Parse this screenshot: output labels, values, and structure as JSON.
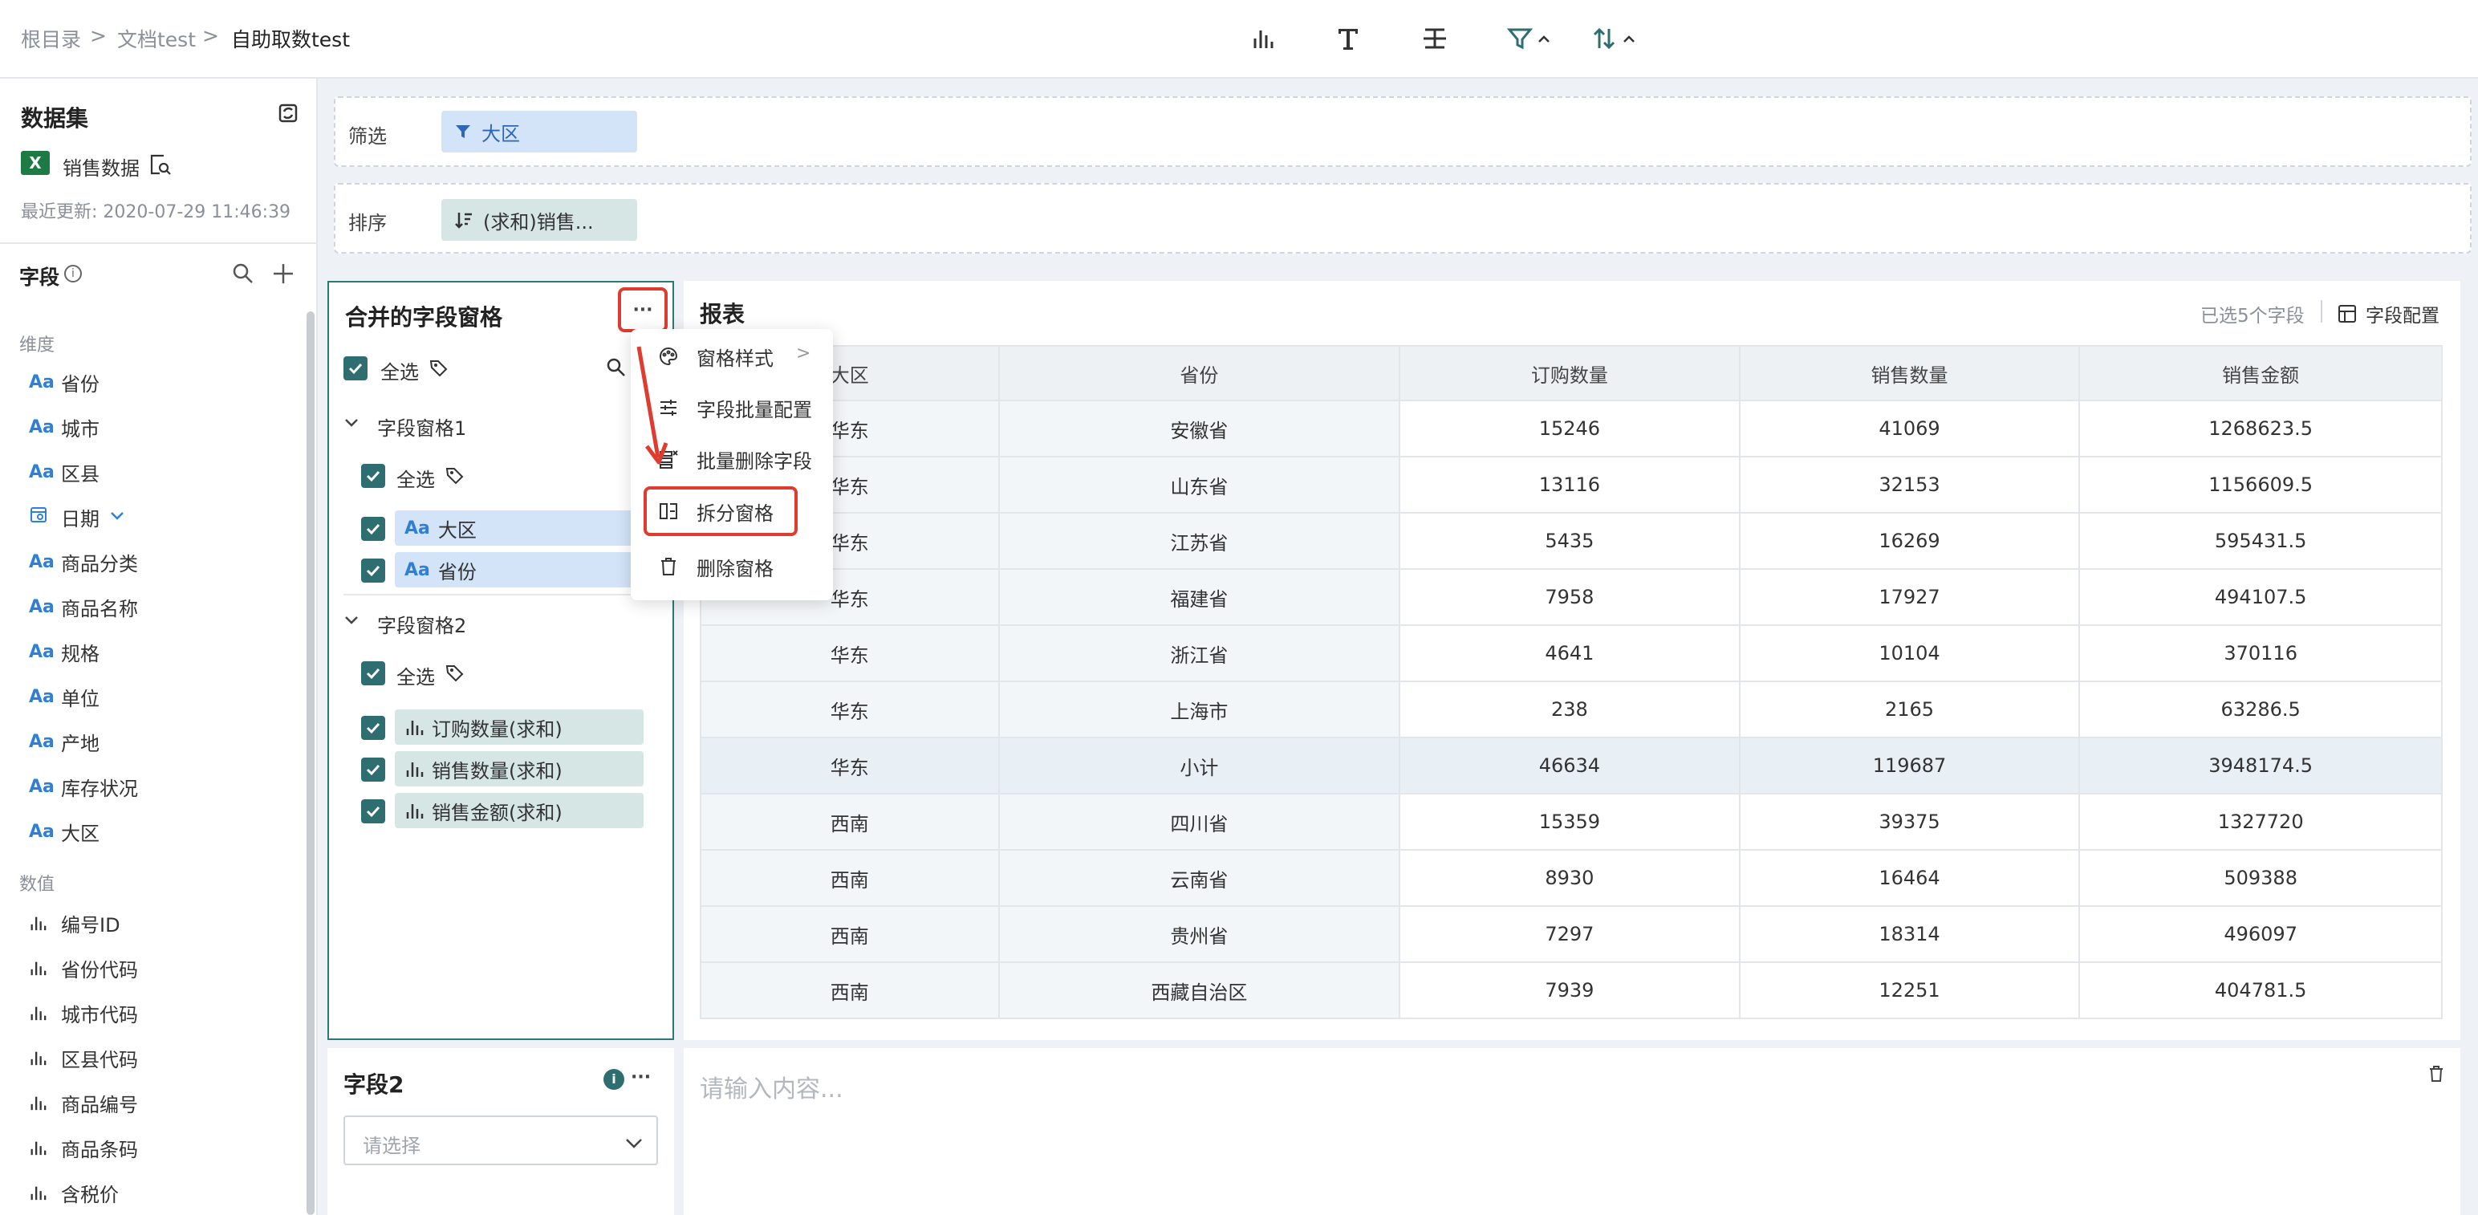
{
  "breadcrumb": {
    "root": "根目录",
    "sep1": ">",
    "folder": "文档test",
    "sep2": ">",
    "current": "自助取数test"
  },
  "toolbar": {
    "icons": [
      "bar-chart-icon",
      "text-icon",
      "divider-icon",
      "filter-icon",
      "sort-icon"
    ]
  },
  "sidebar": {
    "dataset_title": "数据集",
    "dataset_name": "销售数据",
    "updated": "最近更新: 2020-07-29 11:46:39",
    "fields_title": "字段",
    "dim_title": "维度",
    "dims": [
      "省份",
      "城市",
      "区县",
      "日期",
      "商品分类",
      "商品名称",
      "规格",
      "单位",
      "产地",
      "库存状况",
      "大区"
    ],
    "measure_title": "数值",
    "measures": [
      "编号ID",
      "省份代码",
      "城市代码",
      "区县代码",
      "商品编号",
      "商品条码",
      "含税价"
    ],
    "aa": "Aa"
  },
  "filter": {
    "label": "筛选",
    "chip": "大区"
  },
  "sort": {
    "label": "排序",
    "chip": "(求和)销售..."
  },
  "merged": {
    "title": "合并的字段窗格",
    "more": "···",
    "select_all": "全选",
    "group1": {
      "title": "字段窗格1",
      "select_all": "全选",
      "fields": [
        "大区",
        "省份"
      ]
    },
    "group2": {
      "title": "字段窗格2",
      "select_all": "全选",
      "fields": [
        "订购数量(求和)",
        "销售数量(求和)",
        "销售金额(求和)"
      ]
    }
  },
  "menu": {
    "items": [
      "窗格样式",
      "字段批量配置",
      "批量删除字段",
      "拆分窗格",
      "删除窗格"
    ],
    "arrow": ">"
  },
  "report": {
    "title": "报表",
    "selected": "已选5个字段",
    "config": "字段配置",
    "columns": [
      "大区",
      "省份",
      "订购数量",
      "销售数量",
      "销售金额"
    ],
    "rows": [
      [
        "华东",
        "安徽省",
        "15246",
        "41069",
        "1268623.5"
      ],
      [
        "华东",
        "山东省",
        "13116",
        "32153",
        "1156609.5"
      ],
      [
        "华东",
        "江苏省",
        "5435",
        "16269",
        "595431.5"
      ],
      [
        "华东",
        "福建省",
        "7958",
        "17927",
        "494107.5"
      ],
      [
        "华东",
        "浙江省",
        "4641",
        "10104",
        "370116"
      ],
      [
        "华东",
        "上海市",
        "238",
        "2165",
        "63286.5"
      ],
      [
        "华东",
        "小计",
        "46634",
        "119687",
        "3948174.5"
      ],
      [
        "西南",
        "四川省",
        "15359",
        "39375",
        "1327720"
      ],
      [
        "西南",
        "云南省",
        "8930",
        "16464",
        "509388"
      ],
      [
        "西南",
        "贵州省",
        "7297",
        "18314",
        "496097"
      ],
      [
        "西南",
        "西藏自治区",
        "7939",
        "12251",
        "404781.5"
      ]
    ]
  },
  "field2": {
    "title": "字段2",
    "placeholder": "请选择",
    "more": "···"
  },
  "editor": {
    "placeholder": "请输入内容..."
  },
  "colors": {
    "accent": "#2f6e70",
    "highlight": "#e03b2f",
    "chip_blue": "#d3e4f8",
    "chip_teal": "#d5e6e5"
  }
}
